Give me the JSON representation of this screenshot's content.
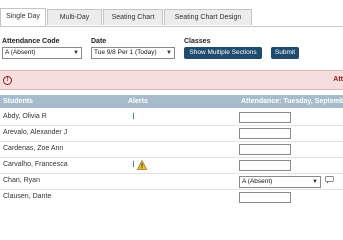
{
  "tabs": [
    {
      "label": "Single Day",
      "active": true
    },
    {
      "label": "Multi-Day",
      "active": false
    },
    {
      "label": "Seating Chart",
      "active": false
    },
    {
      "label": "Seating Chart Design",
      "active": false
    }
  ],
  "filters": {
    "attendance_code": {
      "label": "Attendance Code",
      "value": "A (Absent)"
    },
    "date": {
      "label": "Date",
      "value": "Tue 9/8 Per 1 (Today)"
    },
    "classes": {
      "label": "Classes",
      "show_multiple_label": "Show Multiple Sections",
      "submit_label": "Submit"
    }
  },
  "alert": {
    "text": "Att"
  },
  "table": {
    "headers": {
      "students": "Students",
      "alerts": "Alerts",
      "attendance": "Attendance: Tuesday, Septemb"
    },
    "rows": [
      {
        "name": "Abdy, Olivia R",
        "alerts": [
          "info"
        ],
        "attendance": ""
      },
      {
        "name": "Arevalo, Alexander J",
        "alerts": [],
        "attendance": ""
      },
      {
        "name": "Cardenas, Zoe Ann",
        "alerts": [],
        "attendance": ""
      },
      {
        "name": "Carvalho, Francesca",
        "alerts": [
          "info",
          "warning"
        ],
        "attendance": ""
      },
      {
        "name": "Chan, Ryan",
        "alerts": [],
        "attendance": "A (Absent)"
      },
      {
        "name": "Clausen, Dante",
        "alerts": [],
        "attendance": ""
      }
    ]
  },
  "colors": {
    "button": "#1f4b6e",
    "header": "#a7bccb",
    "alert_bg": "#f7dede",
    "alert_text": "#a01818"
  }
}
